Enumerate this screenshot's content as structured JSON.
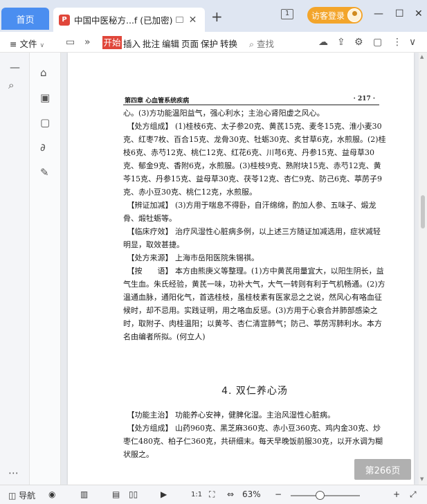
{
  "titlebar": {
    "home_tab": "首页",
    "doc_tab_title": "中国中医秘方...f (已加密)",
    "new_tab": "+",
    "window_count": "1",
    "login_button": "访客登录",
    "minimize": "—",
    "maximize": "☐",
    "close": "✕"
  },
  "toolbar": {
    "menu": "≡ 文件",
    "start": "开始",
    "insert": "插入",
    "annotate": "批注",
    "edit": "编辑",
    "page": "页面",
    "protect": "保护",
    "convert": "转换",
    "search": "查找"
  },
  "page": {
    "chapter": "第四章  心血管系统疾病",
    "number": "· 217 ·",
    "paragraphs": [
      "心。(3)方功能温阳益气，强心利水；主治心肾阳虚之风心。",
      "　【处方组成】 (1)桂枝6克、太子参20克、黄芪15克、麦冬15克、淮小麦30克、红枣7枚、百合15克、龙骨30克、牡蛎30克、炙甘草6克，水煎服。(2)桂枝6克、赤芍12克、桃仁12克、红花6克、川芎6克、丹参15克、益母草30克、郁金9克、香附6克，水煎服。(3)桂枝9克、熟附块15克、赤芍12克、黄芩15克、丹参15克、益母草30克、茯苓12克、杏仁9克、防己6克、葶苈子9克、赤小豆30克、桃仁12克，水煎服。",
      "　【辨证加减】 (3)方用于喘息不得卧，自汗绵绵，酌加人参、五味子、煅龙骨、煅牡蛎等。",
      "　【临床疗效】 治疗风湿性心脏病多例，以上述三方随证加减选用，症状减轻明显，取效甚捷。",
      "　【处方来源】 上海市岳阳医院朱锡祺。",
      "　【按　　语】 本方由熊庚义等整理。(1)方中黄芪用量宜大，以阳生阴长，益气生血。朱氏经验，黄芪一味，功补大气，大气一转则有利于气机畅通。(2)方温通血脉，通阳化气，首选桂枝，虽桂枝素有医家忌之之说，然风心有咯血征候时，却不忌用。实践证明，用之咯血反惩。(3)方用于心衰合并肺部感染之时，取附子、肉桂温阳；以黄芩、杏仁清宣肺气；防己、葶苈泻肺利水。本方名由编者所拟。(何立人)"
    ],
    "heading": "4. 双仁养心汤",
    "paragraphs2": [
      "　【功能主治】 功能养心安神，健脾化湿。主治风湿性心脏病。",
      "　【处方组成】 山药960克、黑芝麻360克、赤小豆360克、鸡内金30克、炒枣仁480克、柏子仁360克，共研细末。每天早晚饭前服30克，以开水调为糊状服之。"
    ],
    "page_indicator": "第266页"
  },
  "statusbar": {
    "nav": "导航",
    "zoom": "63%",
    "zoom_minus": "−",
    "zoom_plus": "+",
    "page_ratio": "1:1"
  }
}
